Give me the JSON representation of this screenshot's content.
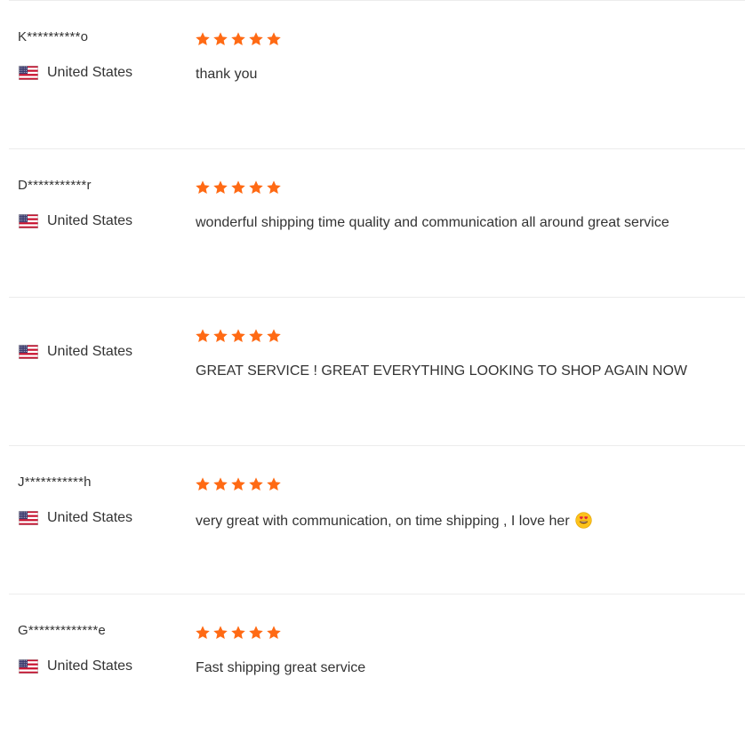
{
  "colors": {
    "star": "#ff6a14",
    "text": "#333333",
    "divider": "#ececec"
  },
  "reviews": [
    {
      "buyer": "K**********o",
      "country": "United States",
      "flag_icon": "us-flag-icon",
      "rating": 5,
      "text": "thank you"
    },
    {
      "buyer": "D***********r",
      "country": "United States",
      "flag_icon": "us-flag-icon",
      "rating": 5,
      "text": "wonderful shipping time quality and communication all around great service"
    },
    {
      "buyer": "",
      "country": "United States",
      "flag_icon": "us-flag-icon",
      "rating": 5,
      "text": "GREAT SERVICE ! GREAT EVERYTHING LOOKING TO SHOP AGAIN NOW"
    },
    {
      "buyer": "J***********h",
      "country": "United States",
      "flag_icon": "us-flag-icon",
      "rating": 5,
      "text": "very great with communication, on time shipping , I love her",
      "emoji_icon": "heart-eyes-emoji-icon"
    },
    {
      "buyer": "G*************e",
      "country": "United States",
      "flag_icon": "us-flag-icon",
      "rating": 5,
      "text": "Fast shipping great service"
    }
  ]
}
